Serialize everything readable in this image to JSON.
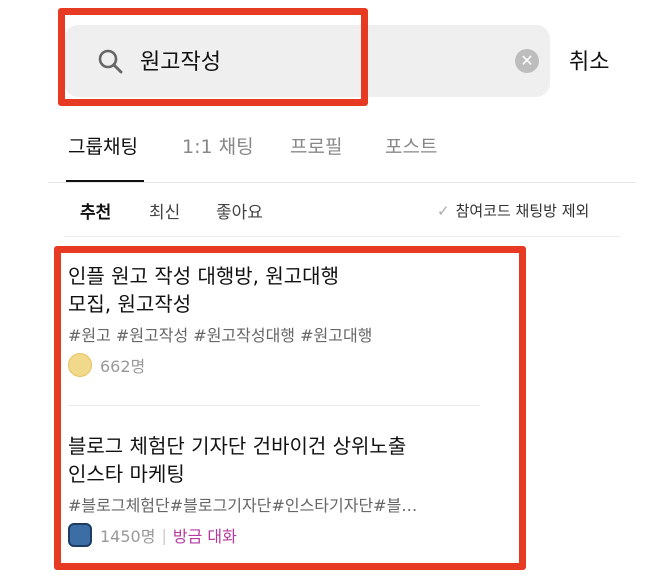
{
  "search": {
    "query": "원고작성",
    "cancel_label": "취소"
  },
  "tabs": [
    {
      "label": "그룹채팅",
      "active": true
    },
    {
      "label": "1:1 채팅"
    },
    {
      "label": "프로필"
    },
    {
      "label": "포스트"
    }
  ],
  "filters": {
    "items": [
      {
        "label": "추천",
        "active": true
      },
      {
        "label": "최신"
      },
      {
        "label": "좋아요"
      }
    ],
    "exclude_label": "참여코드 채팅방 제외"
  },
  "results": [
    {
      "title_line1": "인플 원고 작성 대행방, 원고대행",
      "title_line2": "모집, 원고작성",
      "tags": "#원고 #원고작성 #원고작성대행 #원고대행",
      "members": "662명"
    },
    {
      "title_line1": "블로그 체험단 기자단 건바이건 상위노출",
      "title_line2": "인스타 마케팅",
      "tags": "#블로그체험단#블로그기자단#인스타기자단#블…",
      "members": "1450명",
      "recent": "방금 대화"
    }
  ],
  "colors": {
    "highlight": "#e73a22",
    "recent": "#b53aa0",
    "search_bg": "#efefef"
  }
}
